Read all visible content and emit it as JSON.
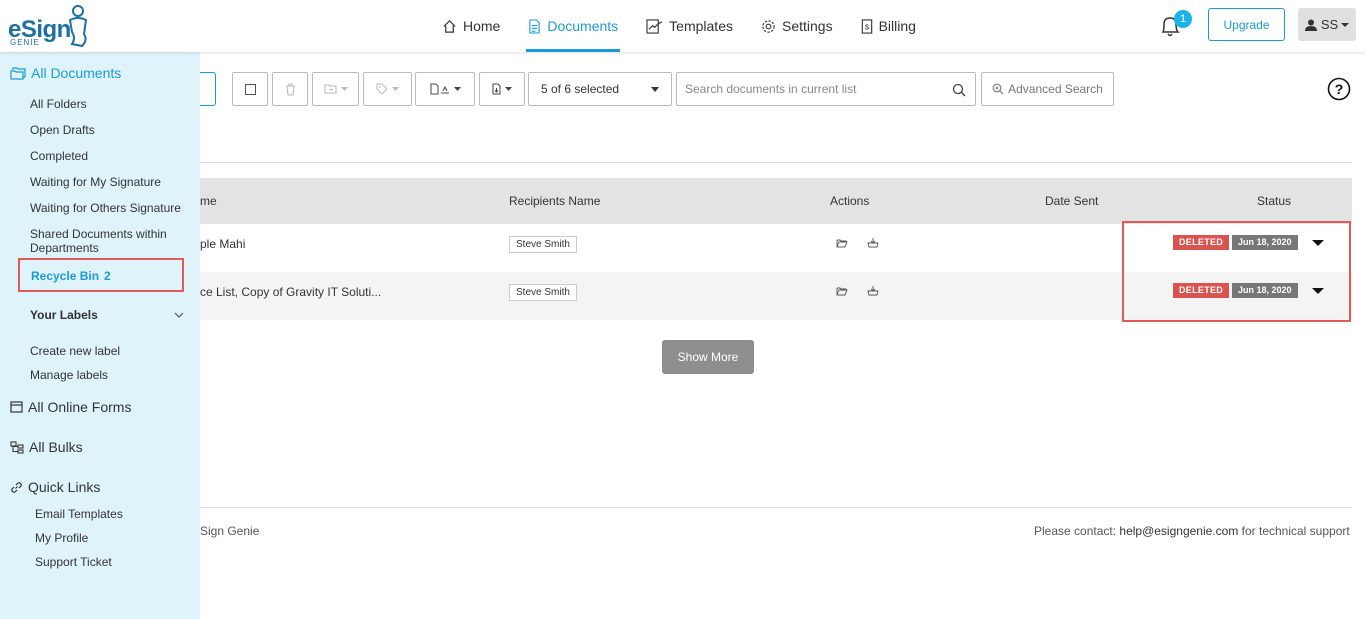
{
  "logo": {
    "brand": "eSign",
    "sub": "GENIE"
  },
  "nav": {
    "items": [
      {
        "label": "Home",
        "icon": "home-icon"
      },
      {
        "label": "Documents",
        "icon": "document-icon",
        "active": true
      },
      {
        "label": "Templates",
        "icon": "template-icon"
      },
      {
        "label": "Settings",
        "icon": "gear-icon"
      },
      {
        "label": "Billing",
        "icon": "billing-icon"
      }
    ],
    "notifications": "1",
    "upgrade_label": "Upgrade",
    "user_initials": "SS"
  },
  "sidebar": {
    "all_documents": "All Documents",
    "items": [
      "All Folders",
      "Open Drafts",
      "Completed",
      "Waiting for My Signature",
      "Waiting for Others Signature",
      "Shared Documents within Departments"
    ],
    "recycle_bin": {
      "label": "Recycle Bin",
      "count": "2"
    },
    "your_labels": "Your Labels",
    "label_actions": [
      "Create new label",
      "Manage labels"
    ],
    "all_online_forms": "All Online Forms",
    "all_bulks": "All Bulks",
    "quick_links": "Quick Links",
    "quick_link_items": [
      "Email Templates",
      "My Profile",
      "Support Ticket"
    ]
  },
  "toolbar": {
    "selection": "5 of 6 selected",
    "search_placeholder": "Search documents in current list",
    "advanced_search": "Advanced Search"
  },
  "table": {
    "headers": {
      "name": "me",
      "recipients": "Recipients Name",
      "actions": "Actions",
      "date_sent": "Date Sent",
      "status": "Status"
    },
    "rows": [
      {
        "name": "ple Mahi",
        "recipient": "Steve Smith",
        "status": "DELETED",
        "date": "Jun 18, 2020"
      },
      {
        "name": "ce List, Copy of Gravity IT Soluti...",
        "recipient": "Steve Smith",
        "status": "DELETED",
        "date": "Jun 18, 2020"
      }
    ]
  },
  "show_more": "Show More",
  "footer": {
    "left": "Sign Genie",
    "contact_prefix": "Please contact: ",
    "email": "help@esigngenie.com",
    "contact_suffix": " for technical support"
  },
  "colors": {
    "accent": "#1a9bd7",
    "sidebar_bg": "#dff3fb",
    "deleted": "#d9534f",
    "highlight": "#e05a5a"
  }
}
